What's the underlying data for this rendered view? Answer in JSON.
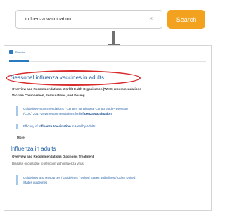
{
  "search": {
    "value": "influenza vaccination",
    "clear_glyph": "×",
    "button_label": "Search"
  },
  "results_tab": {
    "label": "Results",
    "icon": "results-icon"
  },
  "results": [
    {
      "title": "Seasonal influenza vaccines in adults",
      "meta_line1": "Overview and Recommendations    World Health Organization (WHO) recommendations",
      "meta_line2": "Vaccine Composition, Formulations, and Dosing",
      "snippets": [
        {
          "line1": "Guideline Recommendations / Centers for Disease Control and Prevention",
          "line2_pre": "(CDC) 2017-2018 recommendations for ",
          "line2_bold": "influenza vaccination"
        },
        {
          "pre": "Efficacy of ",
          "bold": "Influenza Vaccination",
          "post": " in Healthy Adults"
        }
      ],
      "more": "More"
    },
    {
      "title": "Influenza in adults",
      "meta_line1": "Overview and Recommendations    Diagnosis    Treatment",
      "description": "Disease occurs due to infection with influenza virus",
      "snippets": [
        {
          "line1": "Guidelines and Resources / Guidelines / United States guidelines / Other United",
          "line2": "States guidelines"
        }
      ]
    }
  ],
  "colors": {
    "search_button": "#f3a21f",
    "highlight": "#d92b2b",
    "link": "#1f5da3",
    "arrow": "#707070"
  }
}
